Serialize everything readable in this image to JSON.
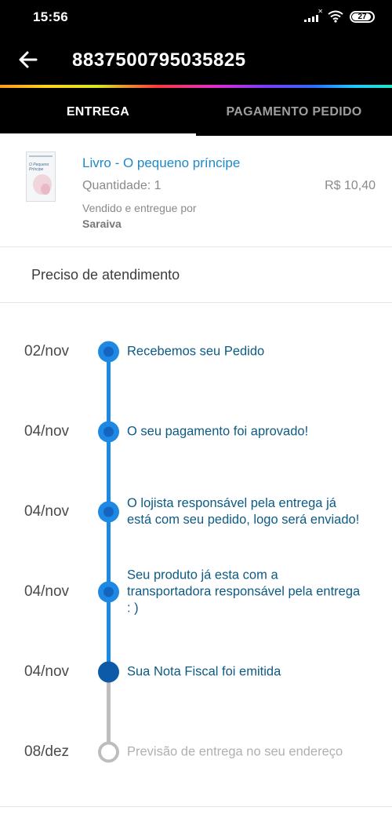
{
  "status_bar": {
    "time": "15:56",
    "signal_icon": "signal-icon",
    "wifi_icon": "wifi-icon",
    "battery_level": "27"
  },
  "app_bar": {
    "back_icon": "arrow-left-icon",
    "title": "8837500795035825"
  },
  "tabs": [
    {
      "label": "ENTREGA",
      "active": true
    },
    {
      "label": "PAGAMENTO PEDIDO",
      "active": false
    }
  ],
  "product": {
    "name": "Livro - O pequeno príncipe",
    "quantity": "Quantidade: 1",
    "price": "R$ 10,40",
    "sold_by_label": "Vendido e entregue por",
    "seller": "Saraiva"
  },
  "help": {
    "label": "Preciso de atendimento"
  },
  "timeline": [
    {
      "date": "02/nov",
      "text": "Recebemos seu Pedido",
      "state": "done"
    },
    {
      "date": "04/nov",
      "text": "O seu pagamento foi aprovado!",
      "state": "done"
    },
    {
      "date": "04/nov",
      "text": "O lojista responsável pela entrega já está com seu pedido, logo será enviado!",
      "state": "done"
    },
    {
      "date": "04/nov",
      "text": "Seu produto já esta com a transportadora responsável pela entrega : )",
      "state": "done"
    },
    {
      "date": "04/nov",
      "text": "Sua Nota Fiscal foi emitida",
      "state": "current"
    },
    {
      "date": "08/dez",
      "text": "Previsão de entrega no seu endereço",
      "state": "pending"
    }
  ],
  "colors": {
    "accent_blue": "#1e88e5",
    "link_blue": "#1e88c8",
    "pending_gray": "#bdbdbd"
  }
}
